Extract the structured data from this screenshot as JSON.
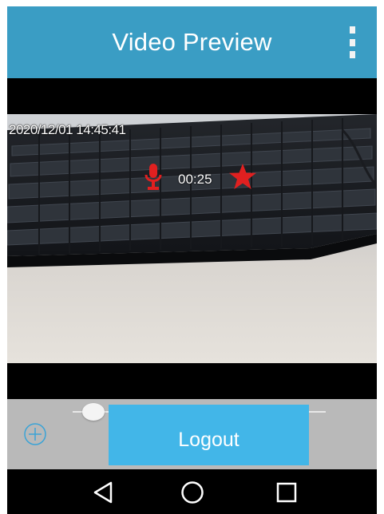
{
  "app_bar": {
    "title": "Video Preview",
    "menu_icon": "overflow-menu-icon",
    "background_color": "#3a9dc4"
  },
  "video": {
    "timestamp": "2020/12/01 14:45:41",
    "recording_time": "00:25",
    "icons": [
      "microphone-icon",
      "star-icon"
    ],
    "overlay_icon_color": "#e02020"
  },
  "controls": {
    "zoom_icon": "zoom-in-icon",
    "logout_label": "Logout",
    "logout_color": "#42b6e8"
  },
  "navigation": {
    "buttons": [
      "back-icon",
      "home-icon",
      "recents-icon"
    ]
  }
}
